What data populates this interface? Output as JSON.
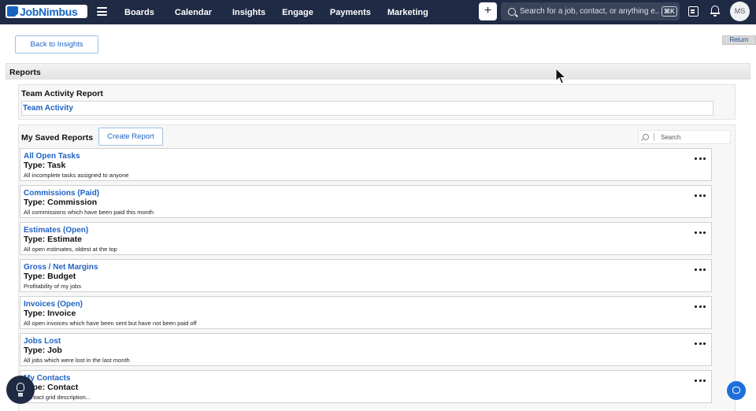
{
  "topbar": {
    "logo_text": "JobNimbus",
    "nav_items": [
      "Boards",
      "Calendar",
      "Insights",
      "Engage",
      "Payments",
      "Marketing"
    ],
    "add_label": "+",
    "search_placeholder": "Search for a job, contact, or anything e...",
    "search_shortcut": "⌘K",
    "avatar_initials": "MS"
  },
  "page": {
    "back_label": "Back to Insights",
    "return_label": "Return",
    "section_title": "Reports"
  },
  "team_activity": {
    "heading": "Team Activity Report",
    "link": "Team Activity"
  },
  "saved": {
    "heading": "My Saved Reports",
    "create_label": "Create Report",
    "search_placeholder": "Search",
    "reports": [
      {
        "title": "All Open Tasks",
        "type": "Type: Task",
        "desc": "All incomplete tasks assigned to anyone"
      },
      {
        "title": "Commissions (Paid)",
        "type": "Type: Commission",
        "desc": "All commissions which have been paid this month"
      },
      {
        "title": "Estimates (Open)",
        "type": "Type: Estimate",
        "desc": "All open estimates, oldest at the top"
      },
      {
        "title": "Gross / Net Margins",
        "type": "Type: Budget",
        "desc": "Profitability of my jobs"
      },
      {
        "title": "Invoices (Open)",
        "type": "Type: Invoice",
        "desc": "All open invoices which have been sent but have not been paid off"
      },
      {
        "title": "Jobs Lost",
        "type": "Type: Job",
        "desc": "All jobs which were lost in the last month"
      },
      {
        "title": "My Contacts",
        "type": "Type: Contact",
        "desc": "Contact grid description..."
      }
    ]
  },
  "icons": {
    "menu": "hamburger-icon",
    "search": "search-icon",
    "notes": "notes-icon",
    "bell": "bell-icon",
    "help": "lightbulb-icon",
    "chat": "chat-icon",
    "more": "ellipsis-icon"
  },
  "colors": {
    "nav_bg": "#1f2a44",
    "link_blue": "#1e63c4",
    "chat_blue": "#1e6fd9"
  }
}
